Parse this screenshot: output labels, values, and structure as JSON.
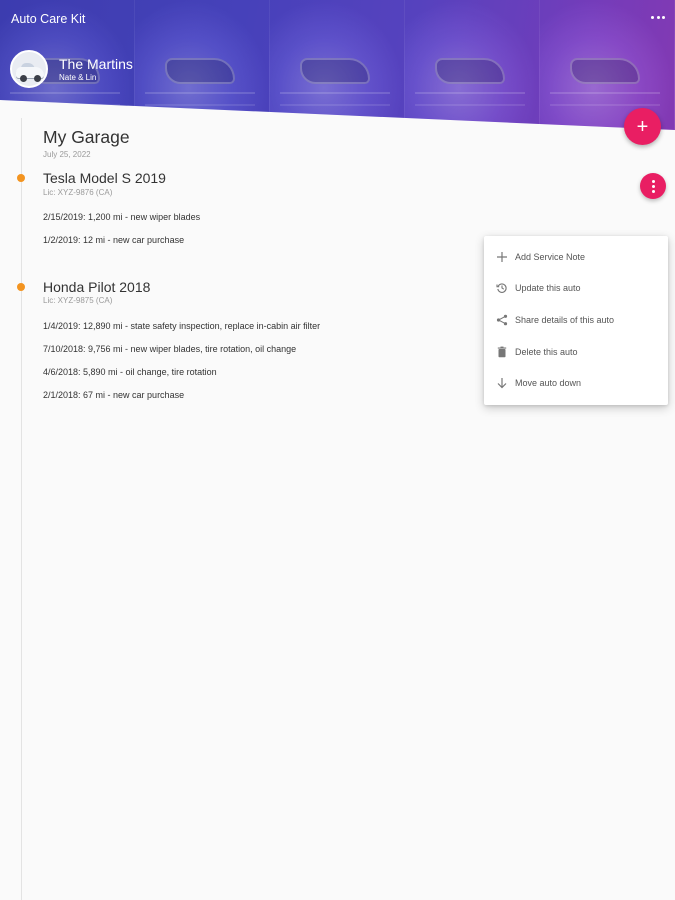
{
  "app": {
    "title": "Auto Care Kit"
  },
  "profile": {
    "family_name": "The Martins",
    "members": "Nate & Lin"
  },
  "fab": {
    "add_symbol": "+"
  },
  "garage": {
    "title": "My Garage",
    "date": "July 25, 2022",
    "vehicles": [
      {
        "name": "Tesla Model S 2019",
        "plate": "Lic: XYZ-9876 (CA)",
        "notes": [
          "2/15/2019: 1,200 mi - new wiper blades",
          "1/2/2019: 12 mi - new car purchase"
        ]
      },
      {
        "name": "Honda Pilot 2018",
        "plate": "Lic: XYZ-9875 (CA)",
        "notes": [
          "1/4/2019: 12,890 mi - state safety inspection, replace in-cabin air filter",
          "7/10/2018: 9,756 mi - new wiper blades, tire rotation, oil change",
          "4/6/2018: 5,890 mi - oil change, tire rotation",
          "2/1/2018: 67 mi - new car purchase"
        ]
      }
    ]
  },
  "menu": {
    "items": [
      {
        "label": "Add Service Note",
        "icon": "plus-icon"
      },
      {
        "label": "Update this auto",
        "icon": "history-icon"
      },
      {
        "label": "Share details of this auto",
        "icon": "share-icon"
      },
      {
        "label": "Delete this auto",
        "icon": "trash-icon"
      },
      {
        "label": "Move auto down",
        "icon": "arrow-down-icon"
      }
    ]
  },
  "colors": {
    "accent": "#e91e63",
    "timeline_dot": "#f39420",
    "header_start": "#3f3fb8",
    "header_end": "#8a3cbd"
  }
}
